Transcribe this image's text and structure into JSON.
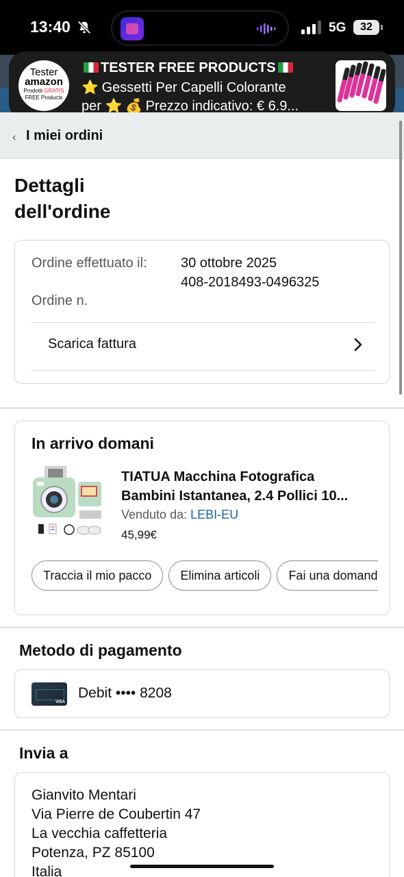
{
  "status_bar": {
    "time": "13:40",
    "network": "5G",
    "battery": "32"
  },
  "notification": {
    "logo_line1": "Tester",
    "logo_line2": "amazon",
    "logo_line3a": "Prodotti ",
    "logo_line3b": "GRATIS",
    "logo_line4": "FREE Products",
    "title": "TESTER FREE PRODUCTS",
    "line2": "Gessetti Per Capelli Colorante",
    "line3": "Prezzo indicativo: € 6.9...",
    "line3_prefix": "per",
    "icons": [
      "italy-flag-icon",
      "star-icon",
      "money-bag-icon"
    ]
  },
  "breadcrumb": {
    "label": "I miei ordini"
  },
  "page": {
    "title_line1": "Dettagli",
    "title_line2": "dell'ordine"
  },
  "order": {
    "placed_label": "Ordine effettuato il:",
    "placed_value": "30 ottobre 2025",
    "number_label": "Ordine n.",
    "number_value": "408-2018493-0496325",
    "invoice_label": "Scarica fattura"
  },
  "delivery": {
    "heading": "In arrivo domani",
    "product_title_line1": "TIATUA Macchina Fotografica",
    "product_title_line2": "Bambini Istantanea, 2.4 Pollici 10...",
    "sold_by_label": "Venduto da: ",
    "seller": "LEBI-EU",
    "price": "45,99€",
    "actions": [
      "Traccia il mio pacco",
      "Elimina articoli",
      "Fai una domanda"
    ]
  },
  "payment": {
    "heading": "Metodo di pagamento",
    "method": "Debit •••• 8208",
    "card_brand": "VISA"
  },
  "shipping": {
    "heading": "Invia a",
    "lines": [
      "Gianvito Mentari",
      "Via Pierre de Coubertin 47",
      "La vecchia caffetteria",
      "Potenza, PZ 85100",
      "Italia"
    ]
  },
  "colors": {
    "link": "#2162a1",
    "text": "#0f1111",
    "muted": "#565959",
    "border": "#d5d9d9",
    "breadcrumb_bg": "#eaeded",
    "banner_bg": "#1c1c1c"
  }
}
